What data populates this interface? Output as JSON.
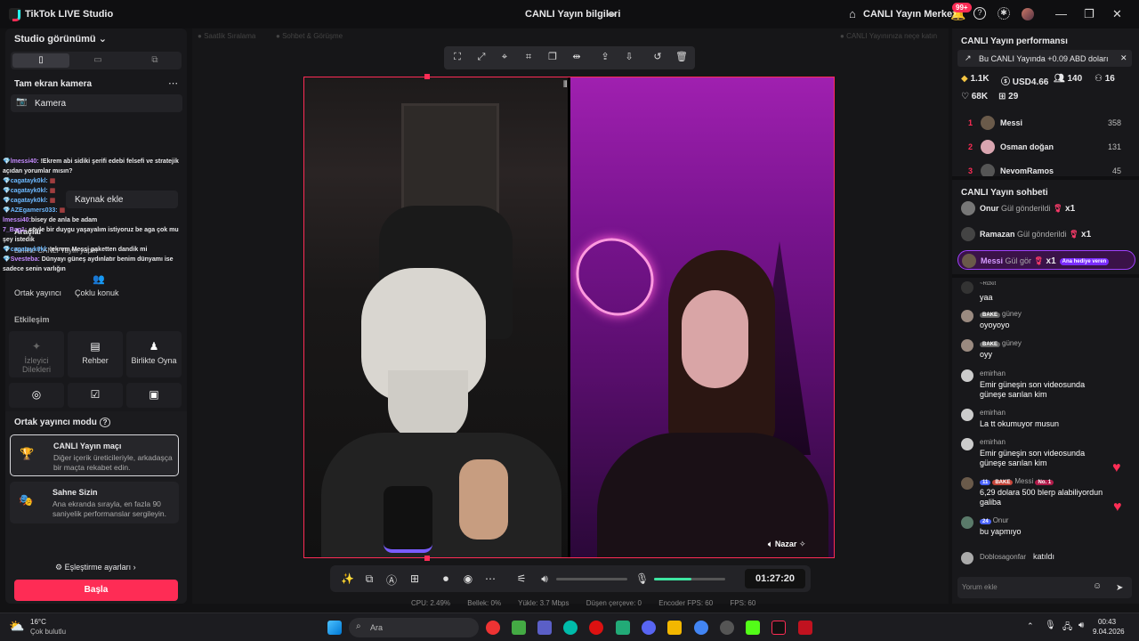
{
  "titlebar": {
    "app_name": "TikTok LIVE Studio",
    "center_title": "CANLI Yayın bilgileri",
    "live_center": "CANLI Yayın Merkezi",
    "notif_badge": "99+"
  },
  "left": {
    "studio_view": "Studio görünümü",
    "scene_title": "Tam ekran kamera",
    "camera_label": "Kamera",
    "add_source": "Kaynak ekle",
    "tools_label": "Araçlar",
    "together_label": "Birlikte CANLI Yayın yapın",
    "cohost": "Ortak yayıncı",
    "multi_guest": "Çoklu konuk",
    "interaction": "Etkileşim",
    "viewer_wishes": "İzleyici Dilekleri",
    "guide": "Rehber",
    "play_together": "Birlikte Oyna",
    "coop_mode": "Ortak yayıncı modu",
    "match_title": "CANLI Yayın maçı",
    "match_desc": "Diğer içerik üreticileriyle, arkadaşça bir maçta rekabet edin.",
    "stage_title": "Sahne Sizin",
    "stage_desc": "Ana ekranda sırayla, en fazla 90 saniyelik performanslar sergileyin.",
    "match_settings": "Eşleştirme ayarları",
    "start": "Başla"
  },
  "overlay_chat": [
    {
      "user": "lmessi40:",
      "text": "!Ekrem abi sidiki şerifi edebi felsefi ve stratejik açıdan yorumlar mısın?"
    },
    {
      "user": "cagatayk0kl:",
      "text": ""
    },
    {
      "user": "cagatayk0kl:",
      "text": ""
    },
    {
      "user": "cagatayk0kl:",
      "text": ""
    },
    {
      "user": "AZEgamers033:",
      "text": ""
    },
    {
      "user": "lmessi40:",
      "text": "bisey de anla be adam"
    },
    {
      "user": "7_Bag1:",
      "text": "şöyle bir duygu yaşayalım istiyoruz be aga çok mu şey istedik"
    },
    {
      "user": "cagatayk0kl:",
      "text": "!ekrem Messi paketten dandik mi"
    },
    {
      "user": "Svesteba:",
      "text": "Dünyayı güneş aydınlatır benim dünyamı ise sadece senin varlığın"
    }
  ],
  "stage": {
    "dim_left_1": "Saatlik Sıralama",
    "dim_left_2": "Sohbet & Görüşme",
    "dim_right": "CANLI Yayınınıza neçe katın",
    "guest_name": "Nazar",
    "timer": "01:27:20"
  },
  "stats": {
    "cpu": "CPU: 2.49%",
    "memory": "Bellek: 0%",
    "upload": "Yükle: 3.7 Mbps",
    "dropped": "Düşen çerçeve: 0",
    "encoder_fps": "Encoder FPS: 60",
    "fps": "FPS: 60"
  },
  "right": {
    "perf_title": "CANLI Yayın performansı",
    "banner": "Bu CANLI Yayında +0.09 ABD doları",
    "coins": "1.1K",
    "usd": "USD4.66",
    "viewers": "140",
    "new_followers": "16",
    "likes": "68K",
    "gifters": "29",
    "ranking": [
      {
        "rank": "1",
        "name": "Messi",
        "score": "358"
      },
      {
        "rank": "2",
        "name": "Osman doğan",
        "score": "131"
      },
      {
        "rank": "3",
        "name": "NevomRamos",
        "score": "45"
      }
    ],
    "chat_title": "CANLI Yayın sohbeti",
    "gifts": [
      {
        "name": "Onur",
        "action": "Gül gönderildi",
        "mult": "x1"
      },
      {
        "name": "Ramazan",
        "action": "Gül gönderildi",
        "mult": "x1"
      },
      {
        "name": "Messi",
        "action": "Gül gör",
        "mult": "x1",
        "tag": "Ana hediye veren"
      }
    ],
    "messages": [
      {
        "name": "~Rizkit",
        "text": "yaa"
      },
      {
        "name": "güney",
        "badge": "BAKE",
        "text": "oyoyoyo"
      },
      {
        "name": "güney",
        "badge": "BAKE",
        "text": "oyy"
      },
      {
        "name": "emirhan",
        "text": "Emir güneşin son videosunda güneşe sarılan kim"
      },
      {
        "name": "emirhan",
        "text": "La tt okumuyor musun"
      },
      {
        "name": "emirhan",
        "text": "Emir güneşin son videosunda güneşe sarılan kim"
      },
      {
        "name": "Messi",
        "badge": "BAKE",
        "level": "11",
        "no1": "No. 1",
        "text": "6,29 dolara 500 blerp alabiliyordun galiba"
      },
      {
        "name": "Onur",
        "level": "24",
        "text": "bu yapmıyo"
      }
    ],
    "joined_name": "Doblosagonfar",
    "joined_text": "katıldı",
    "comment_placeholder": "Yorum ekle"
  },
  "taskbar": {
    "temp": "16°C",
    "weather": "Çok bulutlu",
    "search": "Ara",
    "time": "00:43",
    "date": "9.04.2026"
  }
}
